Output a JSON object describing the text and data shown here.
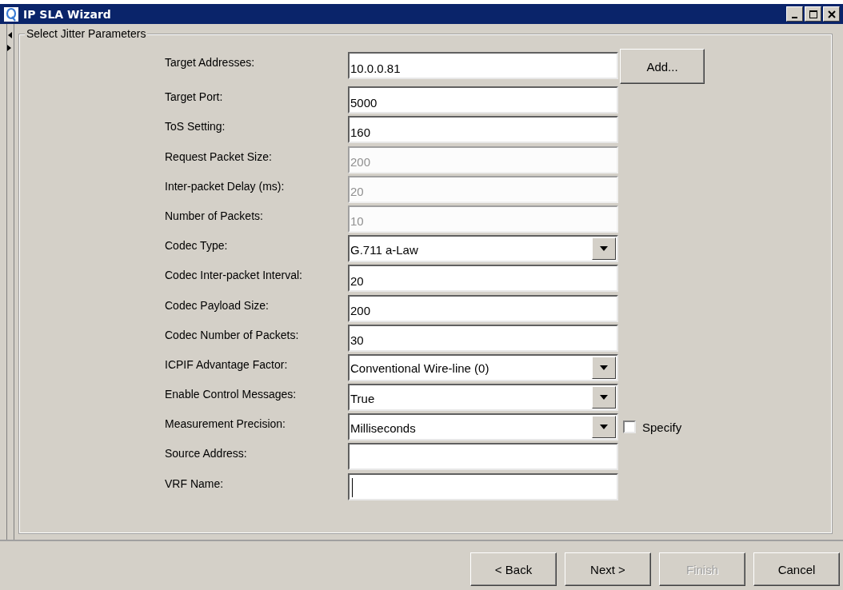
{
  "window": {
    "title": "IP SLA Wizard"
  },
  "group": {
    "title": "Select Jitter Parameters"
  },
  "rows": [
    {
      "label": "Target Addresses:",
      "kind": "text",
      "value": "10.0.0.81",
      "disabled": false,
      "button": "Add..."
    },
    {
      "label": "Target Port:",
      "kind": "text",
      "value": "5000",
      "disabled": false
    },
    {
      "label": "ToS Setting:",
      "kind": "text",
      "value": "160",
      "disabled": false
    },
    {
      "label": "Request Packet Size:",
      "kind": "text",
      "value": "200",
      "disabled": true
    },
    {
      "label": "Inter-packet Delay (ms):",
      "kind": "text",
      "value": "20",
      "disabled": true
    },
    {
      "label": "Number of Packets:",
      "kind": "text",
      "value": "10",
      "disabled": true
    },
    {
      "label": "Codec Type:",
      "kind": "combo",
      "value": "G.711 a-Law",
      "disabled": false
    },
    {
      "label": "Codec Inter-packet Interval:",
      "kind": "text",
      "value": "20",
      "disabled": false
    },
    {
      "label": "Codec Payload Size:",
      "kind": "text",
      "value": "200",
      "disabled": false
    },
    {
      "label": "Codec Number of Packets:",
      "kind": "text",
      "value": "30",
      "disabled": false
    },
    {
      "label": "ICPIF Advantage Factor:",
      "kind": "combo",
      "value": "Conventional Wire-line (0)",
      "disabled": false
    },
    {
      "label": "Enable Control Messages:",
      "kind": "combo",
      "value": "True",
      "disabled": false
    },
    {
      "label": "Measurement Precision:",
      "kind": "combo",
      "value": "Milliseconds",
      "disabled": false,
      "checkbox": {
        "label": "Specify",
        "checked": false
      }
    },
    {
      "label": "Source Address:",
      "kind": "text",
      "disabled": false
    },
    {
      "label": "VRF Name:",
      "kind": "text",
      "disabled": false,
      "focused": true
    }
  ],
  "buttons": [
    {
      "label": "< Back",
      "disabled": false
    },
    {
      "label": "Next >",
      "disabled": false
    },
    {
      "label": "Finish",
      "disabled": true
    },
    {
      "label": "Cancel",
      "disabled": false
    }
  ]
}
